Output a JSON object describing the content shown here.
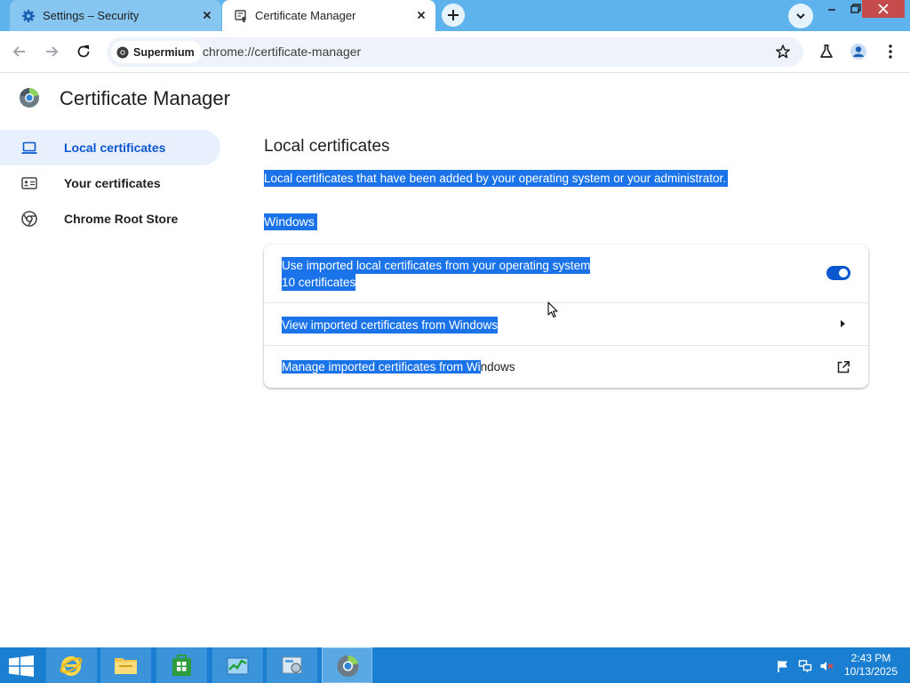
{
  "browser": {
    "tabs": [
      {
        "title": "Settings – Security",
        "favicon": "gear-icon",
        "active": false
      },
      {
        "title": "Certificate Manager",
        "favicon": "certificate-icon",
        "active": true
      }
    ],
    "toolbar": {
      "site_chip": "Supermium",
      "url": "chrome://certificate-manager"
    },
    "colors": {
      "tabstrip": "#5fb3ec",
      "accent": "#0b57d0",
      "selection": "#1a73e8"
    }
  },
  "page": {
    "title": "Certificate Manager",
    "nav": [
      {
        "label": "Local certificates",
        "icon": "laptop-icon",
        "active": true
      },
      {
        "label": "Your certificates",
        "icon": "id-card-icon",
        "active": false
      },
      {
        "label": "Chrome Root Store",
        "icon": "chrome-icon",
        "active": false
      }
    ],
    "section_title": "Local certificates",
    "section_description": "Local certificates that have been added by your operating system or your administrator.",
    "subsection_title": "Windows",
    "rows": [
      {
        "label": "Use imported local certificates from your operating system",
        "sublabel": "10 certificates",
        "control": "toggle",
        "toggle_on": true
      },
      {
        "label": "View imported certificates from Windows",
        "control": "arrow-right-icon"
      },
      {
        "label_selected_part": "Manage imported certificates from Wi",
        "label_rest": "ndows",
        "control": "open-external-icon"
      }
    ]
  },
  "taskbar": {
    "apps": [
      "internet-explorer-icon",
      "file-explorer-icon",
      "store-icon",
      "task-manager-icon",
      "control-panel-icon",
      "supermium-icon"
    ],
    "time": "2:43 PM",
    "date": "10/13/2025"
  }
}
